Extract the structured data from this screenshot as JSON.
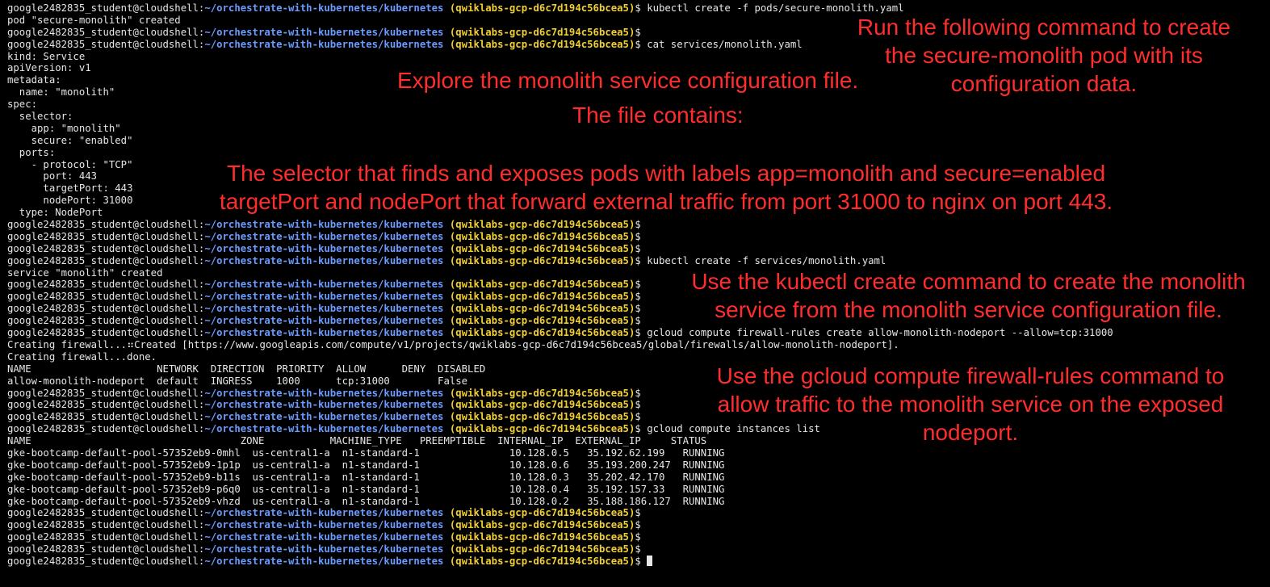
{
  "prompt": {
    "user": "google2482835_student@cloudshell:",
    "path": "~/orchestrate-with-kubernetes/kubernetes",
    "project": "(qwiklabs-gcp-d6c7d194c56bcea5)",
    "symbol": "$"
  },
  "lines": [
    {
      "type": "prompt",
      "cmd": "kubectl create -f pods/secure-monolith.yaml"
    },
    {
      "type": "output",
      "text": "pod \"secure-monolith\" created"
    },
    {
      "type": "prompt",
      "cmd": ""
    },
    {
      "type": "prompt",
      "cmd": "cat services/monolith.yaml"
    },
    {
      "type": "output",
      "text": "kind: Service"
    },
    {
      "type": "output",
      "text": "apiVersion: v1"
    },
    {
      "type": "output",
      "text": "metadata:"
    },
    {
      "type": "output",
      "text": "  name: \"monolith\""
    },
    {
      "type": "output",
      "text": "spec:"
    },
    {
      "type": "output",
      "text": "  selector:"
    },
    {
      "type": "output",
      "text": "    app: \"monolith\""
    },
    {
      "type": "output",
      "text": "    secure: \"enabled\""
    },
    {
      "type": "output",
      "text": "  ports:"
    },
    {
      "type": "output",
      "text": "    - protocol: \"TCP\""
    },
    {
      "type": "output",
      "text": "      port: 443"
    },
    {
      "type": "output",
      "text": "      targetPort: 443"
    },
    {
      "type": "output",
      "text": "      nodePort: 31000"
    },
    {
      "type": "output",
      "text": "  type: NodePort"
    },
    {
      "type": "prompt",
      "cmd": ""
    },
    {
      "type": "prompt",
      "cmd": ""
    },
    {
      "type": "prompt",
      "cmd": ""
    },
    {
      "type": "prompt",
      "cmd": "kubectl create -f services/monolith.yaml"
    },
    {
      "type": "output",
      "text": "service \"monolith\" created"
    },
    {
      "type": "prompt",
      "cmd": ""
    },
    {
      "type": "prompt",
      "cmd": ""
    },
    {
      "type": "prompt",
      "cmd": ""
    },
    {
      "type": "prompt",
      "cmd": ""
    },
    {
      "type": "prompt",
      "cmd": "gcloud compute firewall-rules create allow-monolith-nodeport --allow=tcp:31000"
    },
    {
      "type": "output",
      "text": "Creating firewall...⠶Created [https://www.googleapis.com/compute/v1/projects/qwiklabs-gcp-d6c7d194c56bcea5/global/firewalls/allow-monolith-nodeport]."
    },
    {
      "type": "output",
      "text": "Creating firewall...done."
    },
    {
      "type": "output",
      "text": "NAME                     NETWORK  DIRECTION  PRIORITY  ALLOW      DENY  DISABLED"
    },
    {
      "type": "output",
      "text": "allow-monolith-nodeport  default  INGRESS    1000      tcp:31000        False"
    },
    {
      "type": "prompt",
      "cmd": ""
    },
    {
      "type": "prompt",
      "cmd": ""
    },
    {
      "type": "prompt",
      "cmd": ""
    },
    {
      "type": "prompt",
      "cmd": "gcloud compute instances list"
    },
    {
      "type": "output",
      "text": "NAME                                   ZONE           MACHINE_TYPE   PREEMPTIBLE  INTERNAL_IP  EXTERNAL_IP     STATUS"
    },
    {
      "type": "output",
      "text": "gke-bootcamp-default-pool-57352eb9-0mhl  us-central1-a  n1-standard-1               10.128.0.5   35.192.62.199   RUNNING"
    },
    {
      "type": "output",
      "text": "gke-bootcamp-default-pool-57352eb9-1p1p  us-central1-a  n1-standard-1               10.128.0.6   35.193.200.247  RUNNING"
    },
    {
      "type": "output",
      "text": "gke-bootcamp-default-pool-57352eb9-b11s  us-central1-a  n1-standard-1               10.128.0.3   35.202.42.170   RUNNING"
    },
    {
      "type": "output",
      "text": "gke-bootcamp-default-pool-57352eb9-p6q0  us-central1-a  n1-standard-1               10.128.0.4   35.192.157.33   RUNNING"
    },
    {
      "type": "output",
      "text": "gke-bootcamp-default-pool-57352eb9-vhzd  us-central1-a  n1-standard-1               10.128.0.2   35.188.186.127  RUNNING"
    },
    {
      "type": "prompt",
      "cmd": ""
    },
    {
      "type": "prompt",
      "cmd": ""
    },
    {
      "type": "prompt",
      "cmd": ""
    },
    {
      "type": "prompt",
      "cmd": ""
    },
    {
      "type": "prompt",
      "cmd": "",
      "cursor": true
    }
  ],
  "annotations": {
    "create_pod": "Run the following command to create\nthe secure-monolith pod with its\nconfiguration data.",
    "explore": "Explore the monolith service configuration file.",
    "file_contains": "The file contains:",
    "selector": "The selector that finds and exposes pods with labels app=monolith and secure=enabled\ntargetPort and nodePort that forward external traffic from port 31000 to nginx on port 443.",
    "kubectl_create": "Use the kubectl create command to create the monolith\nservice from the monolith service configuration file.",
    "firewall": "Use the gcloud compute firewall-rules command to\nallow traffic to the monolith service on the exposed\nnodeport."
  },
  "colors": {
    "background": "#000000",
    "text": "#e6e6e6",
    "path": "#6a9bff",
    "project": "#f0ce31",
    "annotation": "#ff2d2d"
  }
}
